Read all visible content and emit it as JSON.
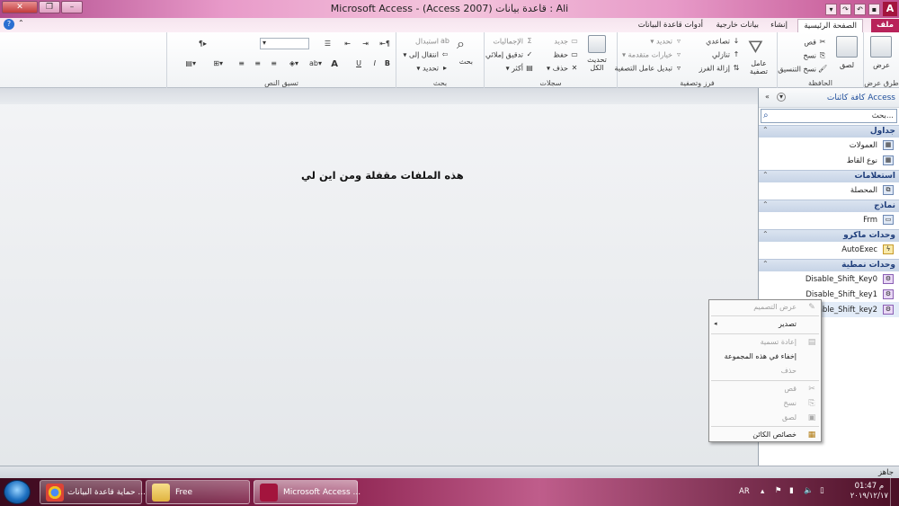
{
  "window": {
    "title": "Microsoft Access  -  (Access 2007) قاعدة بيانات : Ali",
    "app_icon": "A",
    "controls": [
      "close-icon",
      "restore-icon",
      "minimize-icon"
    ]
  },
  "ribbon_tabs": [
    {
      "label": "ملف",
      "type": "file"
    },
    {
      "label": "الصفحة الرئيسية",
      "type": "active"
    },
    {
      "label": "إنشاء",
      "type": "normal"
    },
    {
      "label": "بيانات خارجية",
      "type": "normal"
    },
    {
      "label": "أدوات قاعدة البيانات",
      "type": "normal"
    }
  ],
  "ribbon": {
    "views": {
      "label": "طرق عرض",
      "button": "عرض"
    },
    "clipboard": {
      "label": "الحافظة",
      "paste": "لصق",
      "cut": "قص",
      "copy": "نسخ",
      "format_painter": "نسخ التنسيق"
    },
    "sort_filter": {
      "label": "فرز وتصفية",
      "filter": "عامل تصفية",
      "ascending": "تصاعدي",
      "descending": "تنازلي",
      "remove_sort": "إزالة الفرز",
      "selection": "تحديد",
      "advanced": "خيارات متقدمة",
      "toggle_filter": "تبديل عامل التصفية"
    },
    "records": {
      "label": "سجلات",
      "refresh": "تحديث الكل",
      "new": "جديد",
      "save": "حفظ",
      "delete": "حذف",
      "totals": "الإجماليات",
      "spelling": "تدقيق إملائي",
      "more": "أكثر"
    },
    "find": {
      "label": "بحث",
      "find": "بحث",
      "replace": "استبدال",
      "goto": "انتقال إلى",
      "select": "تحديد"
    },
    "text_formatting": {
      "label": "تسيق النص",
      "bold": "B",
      "italic": "I",
      "underline": "U",
      "font_color": "A"
    }
  },
  "workspace": {
    "message": "هذه الملفات مقفلة ومن اين لي"
  },
  "nav_pane": {
    "title": "كافة كائنات Access",
    "search_placeholder": "بحث...",
    "sections": [
      {
        "label": "جداول",
        "items": [
          "العمولات",
          "نوع القاط"
        ]
      },
      {
        "label": "استعلامات",
        "items": [
          "المحصلة"
        ]
      },
      {
        "label": "نماذج",
        "items": [
          "Frm"
        ]
      },
      {
        "label": "وحدات ماكرو",
        "items": [
          "AutoExec"
        ]
      },
      {
        "label": "وحدات نمطية",
        "items": [
          "Disable_Shift_Key0",
          "Disable_Shift_key1",
          "Disable_Shift_key2"
        ]
      }
    ]
  },
  "context_menu": {
    "items": [
      {
        "label": "عرض التصميم",
        "disabled": true,
        "icon": "design-view-icon"
      },
      {
        "label": "تصدير",
        "disabled": false,
        "submenu": true
      },
      {
        "label": "إعادة تسمية",
        "disabled": true,
        "icon": "rename-icon"
      },
      {
        "label": "إخفاء في هذه المجموعة",
        "disabled": false
      },
      {
        "label": "حذف",
        "disabled": true
      },
      {
        "label": "قص",
        "disabled": true,
        "icon": "cut-icon"
      },
      {
        "label": "نسخ",
        "disabled": true,
        "icon": "copy-icon"
      },
      {
        "label": "لصق",
        "disabled": true,
        "icon": "paste-icon"
      },
      {
        "label": "خصائص الكائن",
        "disabled": false,
        "icon": "properties-icon"
      }
    ]
  },
  "status": {
    "text": "جاهز"
  },
  "taskbar": {
    "buttons": [
      {
        "label": "حماية قاعدة البيانات ..."
      },
      {
        "label": "Free"
      },
      {
        "label": "Microsoft Access ..."
      }
    ],
    "lang": "AR",
    "time": "01:47 م",
    "date": "٢٠١٩/١٢/١٧"
  },
  "colors": {
    "file_tab": "#b8235a",
    "nav_title": "#1f4e9b",
    "section_bg": "#c6d3e6"
  }
}
